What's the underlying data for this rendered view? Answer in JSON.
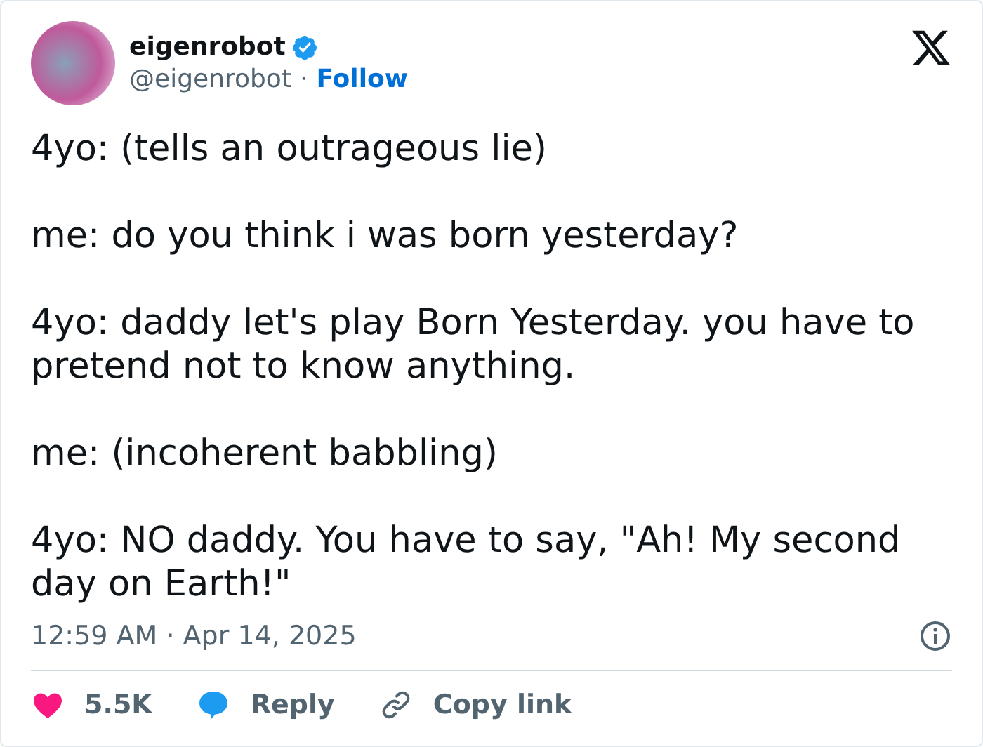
{
  "author": {
    "name": "eigenrobot",
    "verified": true,
    "handle": "@eigenrobot",
    "separator": "·",
    "follow": "Follow"
  },
  "paragraphs": [
    "4yo: (tells an outrageous lie)",
    "me: do you think i was born yesterday?",
    "4yo: daddy let's play Born Yesterday. you have to pretend not to know anything.",
    "me: (incoherent babbling)",
    "4yo: NO daddy. You have to say, \"Ah! My second day on Earth!\""
  ],
  "timestamp": "12:59 AM · Apr 14, 2025",
  "actions": [
    {
      "kind": "like",
      "label": "5.5K"
    },
    {
      "kind": "reply",
      "label": "Reply"
    },
    {
      "kind": "copy",
      "label": "Copy link"
    }
  ]
}
